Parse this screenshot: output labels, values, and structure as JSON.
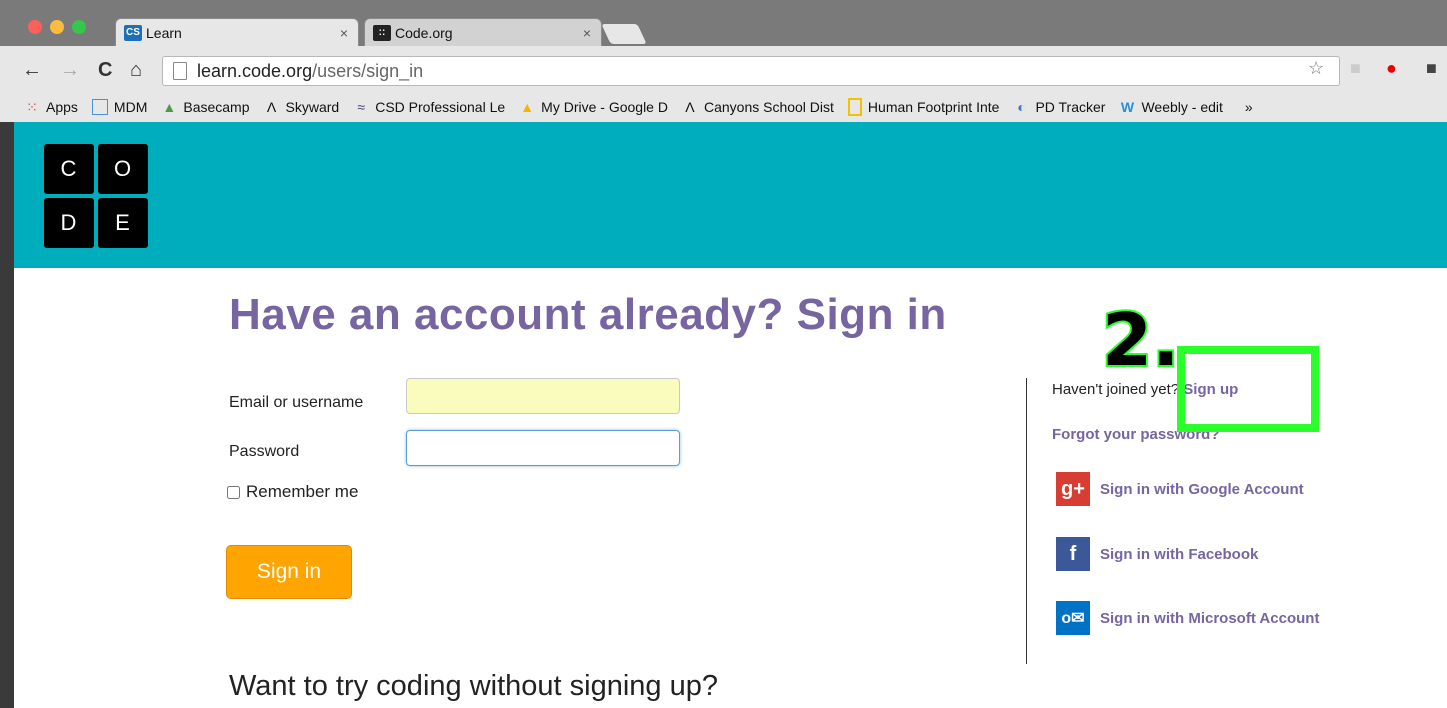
{
  "browser": {
    "tabs": [
      {
        "label": "Learn",
        "favicon": "CS",
        "close": "×"
      },
      {
        "label": "Code.org",
        "favicon": "::",
        "close": "×"
      }
    ],
    "address": {
      "host": "learn.code.org",
      "path": "/users/sign_in"
    },
    "bookmarks": [
      {
        "label": "Apps",
        "icon": "apps-grid-icon"
      },
      {
        "label": "MDM",
        "icon": "folder-icon"
      },
      {
        "label": "Basecamp",
        "icon": "basecamp-icon"
      },
      {
        "label": "Skyward",
        "icon": "skyward-icon"
      },
      {
        "label": "CSD Professional Le",
        "icon": "csd-icon"
      },
      {
        "label": "My Drive - Google D",
        "icon": "google-drive-icon"
      },
      {
        "label": "Canyons School Dist",
        "icon": "canyons-icon"
      },
      {
        "label": "Human Footprint Inte",
        "icon": "footprint-icon"
      },
      {
        "label": "PD Tracker",
        "icon": "pd-tracker-icon"
      },
      {
        "label": "Weebly - edit",
        "icon": "weebly-icon"
      }
    ],
    "overflow": "»"
  },
  "logo": {
    "letters": [
      "C",
      "O",
      "D",
      "E"
    ]
  },
  "form": {
    "heading": "Have an account already? Sign in",
    "email_label": "Email or username",
    "password_label": "Password",
    "remember_label": "Remember me",
    "submit_label": "Sign in",
    "try_text": "Want to try coding without signing up?"
  },
  "side": {
    "not_joined_prefix": "Haven't joined yet?",
    "signup_label": "Sign up",
    "forgot_label": "Forgot your password?",
    "social": [
      {
        "label": "Sign in with Google Account",
        "icon": "google-plus-icon",
        "color": "#d73d32"
      },
      {
        "label": "Sign in with Facebook",
        "icon": "facebook-icon",
        "color": "#3b5998"
      },
      {
        "label": "Sign in with Microsoft Account",
        "icon": "outlook-icon",
        "color": "#0072c6"
      }
    ]
  },
  "annotation": {
    "step_label": "2."
  },
  "colors": {
    "brand_teal": "#00adbc",
    "heading_purple": "#7665a0",
    "button_orange": "#ffa400",
    "highlight_green": "#2bff2b"
  }
}
